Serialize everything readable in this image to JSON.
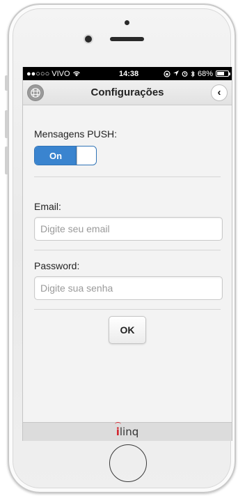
{
  "status_bar": {
    "carrier": "●●○○○ VIVO",
    "time": "14:38",
    "battery": "68%",
    "battery_level": 0.68
  },
  "navbar": {
    "title": "Configurações",
    "left_icon": "grid-icon",
    "right_icon": "chevron-left-icon",
    "back_glyph": "‹"
  },
  "push": {
    "label": "Mensagens PUSH:",
    "toggle_label": "On",
    "state": "on"
  },
  "email": {
    "label": "Email:",
    "value": "",
    "placeholder": "Digite seu email"
  },
  "password": {
    "label": "Password:",
    "value": "",
    "placeholder": "Digite sua senha"
  },
  "ok_button": {
    "label": "OK"
  },
  "footer": {
    "logo_i": "i",
    "logo_rest": "linq"
  },
  "colors": {
    "accent": "#3a84cf",
    "logo_red": "#d3262f"
  }
}
